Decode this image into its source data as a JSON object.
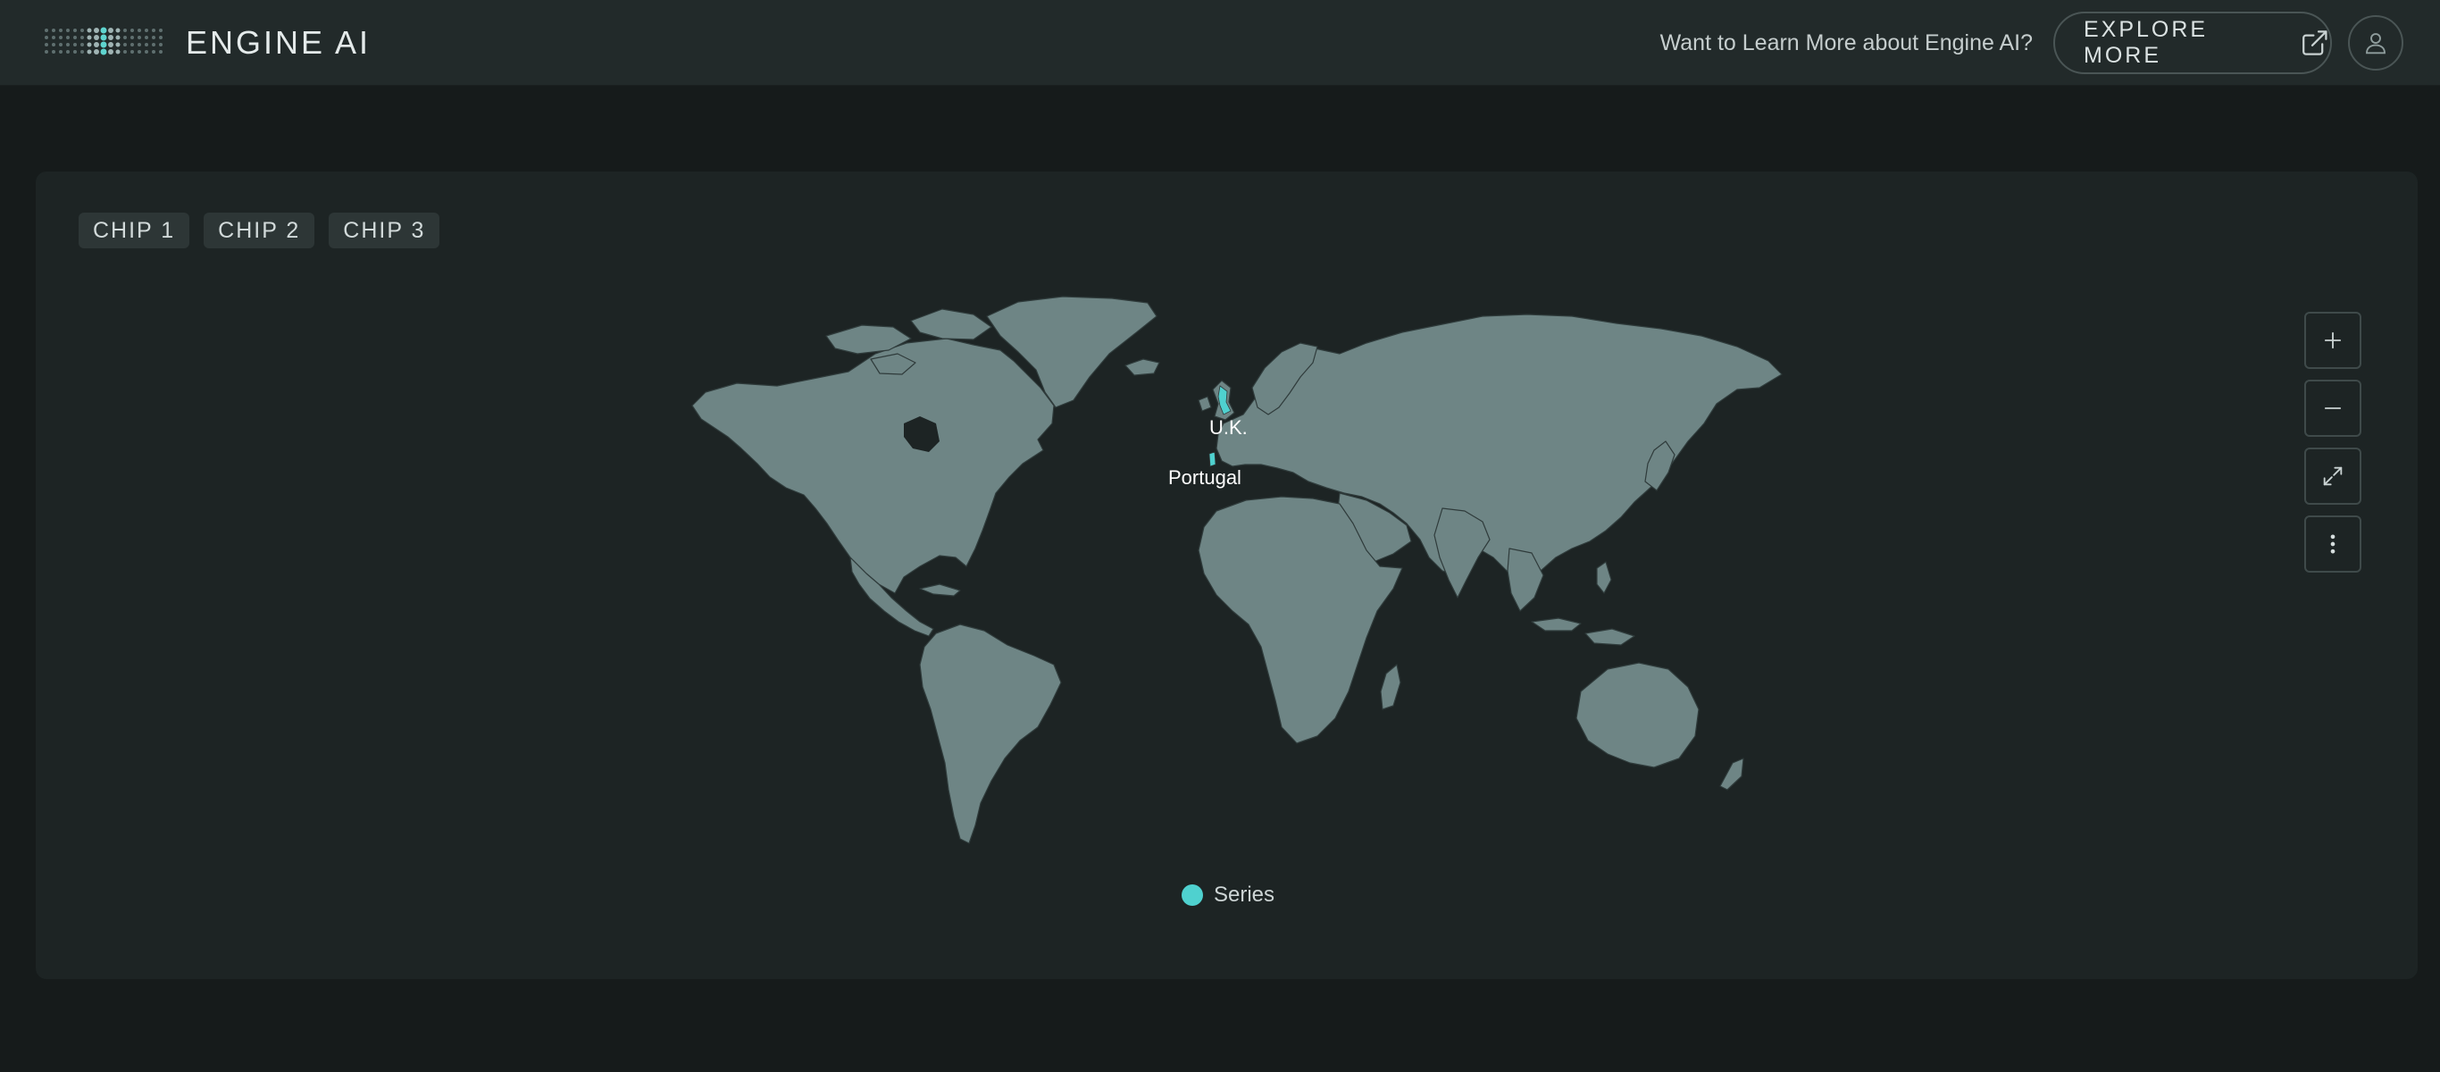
{
  "header": {
    "brand": "ENGINE AI",
    "learn_text": "Want to Learn More about Engine AI?",
    "explore_label": "EXPLORE MORE",
    "explore_icon": "external-link-icon",
    "avatar_icon": "user-icon"
  },
  "chips": [
    {
      "label": "CHIP 1"
    },
    {
      "label": "CHIP 2"
    },
    {
      "label": "CHIP 3"
    }
  ],
  "map": {
    "markers": [
      {
        "label": "U.K."
      },
      {
        "label": "Portugal"
      }
    ],
    "controls": [
      "plus-icon",
      "minus-icon",
      "expand-icon",
      "more-vertical-icon"
    ]
  },
  "legend": {
    "series_name": "Series",
    "series_color": "#4fd1cf"
  },
  "colors": {
    "land": "#6e8585",
    "accent": "#4fd1cf",
    "background": "#161b1b",
    "card": "#1d2424",
    "header": "#222a2a"
  }
}
